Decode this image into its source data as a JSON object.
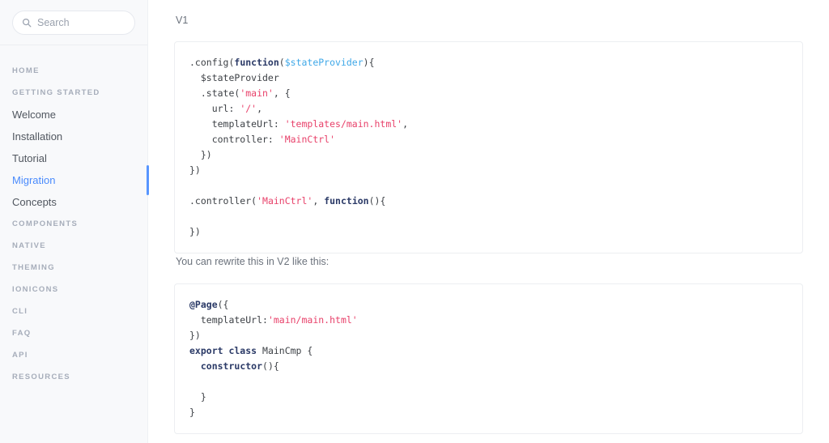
{
  "search": {
    "placeholder": "Search",
    "value": "",
    "icon": "search-icon"
  },
  "sidebar": {
    "items": [
      {
        "label": "HOME",
        "type": "section",
        "active": false
      },
      {
        "label": "GETTING STARTED",
        "type": "section",
        "active": false
      },
      {
        "label": "Welcome",
        "type": "link",
        "active": false
      },
      {
        "label": "Installation",
        "type": "link",
        "active": false
      },
      {
        "label": "Tutorial",
        "type": "link",
        "active": false
      },
      {
        "label": "Migration",
        "type": "link",
        "active": true
      },
      {
        "label": "Concepts",
        "type": "link",
        "active": false
      },
      {
        "label": "COMPONENTS",
        "type": "section",
        "active": false
      },
      {
        "label": "NATIVE",
        "type": "section",
        "active": false
      },
      {
        "label": "THEMING",
        "type": "section",
        "active": false
      },
      {
        "label": "IONICONS",
        "type": "section",
        "active": false
      },
      {
        "label": "CLI",
        "type": "section",
        "active": false
      },
      {
        "label": "FAQ",
        "type": "section",
        "active": false
      },
      {
        "label": "API",
        "type": "section",
        "active": false
      },
      {
        "label": "RESOURCES",
        "type": "section",
        "active": false
      }
    ],
    "active_label": "Migration",
    "accent_color": "#4a8bfc",
    "background_color": "#f8f9fb"
  },
  "main": {
    "heading_v1": "V1",
    "between_text": "You can rewrite this in V2 like this:",
    "code_v1_plain": ".config(function($stateProvider){\n  $stateProvider\n  .state('main', {\n    url: '/',\n    templateUrl: 'templates/main.html',\n    controller: 'MainCtrl'\n  })\n})\n\n.controller('MainCtrl', function(){\n\n})",
    "code_v2_plain": "@Page({\n  templateUrl:'main/main.html'\n})\nexport class MainCmp {\n  constructor(){\n\n  }\n}",
    "code_v1_tokens": [
      [
        {
          "t": ".config(",
          "c": "plain"
        },
        {
          "t": "function",
          "c": "kw"
        },
        {
          "t": "(",
          "c": "punc"
        },
        {
          "t": "$stateProvider",
          "c": "var"
        },
        {
          "t": "){",
          "c": "punc"
        }
      ],
      [
        {
          "t": "  $stateProvider",
          "c": "plain"
        }
      ],
      [
        {
          "t": "  .state(",
          "c": "plain"
        },
        {
          "t": "'main'",
          "c": "str"
        },
        {
          "t": ", {",
          "c": "punc"
        }
      ],
      [
        {
          "t": "    url: ",
          "c": "plain"
        },
        {
          "t": "'/'",
          "c": "str"
        },
        {
          "t": ",",
          "c": "punc"
        }
      ],
      [
        {
          "t": "    templateUrl: ",
          "c": "plain"
        },
        {
          "t": "'templates/main.html'",
          "c": "str"
        },
        {
          "t": ",",
          "c": "punc"
        }
      ],
      [
        {
          "t": "    controller: ",
          "c": "plain"
        },
        {
          "t": "'MainCtrl'",
          "c": "str"
        }
      ],
      [
        {
          "t": "  })",
          "c": "plain"
        }
      ],
      [
        {
          "t": "})",
          "c": "plain"
        }
      ],
      [
        {
          "t": "",
          "c": "plain"
        }
      ],
      [
        {
          "t": ".controller(",
          "c": "plain"
        },
        {
          "t": "'MainCtrl'",
          "c": "str"
        },
        {
          "t": ", ",
          "c": "punc"
        },
        {
          "t": "function",
          "c": "kw"
        },
        {
          "t": "(){",
          "c": "punc"
        }
      ],
      [
        {
          "t": "",
          "c": "plain"
        }
      ],
      [
        {
          "t": "})",
          "c": "plain"
        }
      ]
    ],
    "code_v2_tokens": [
      [
        {
          "t": "@Page",
          "c": "kw"
        },
        {
          "t": "({",
          "c": "punc"
        }
      ],
      [
        {
          "t": "  templateUrl:",
          "c": "plain"
        },
        {
          "t": "'main/main.html'",
          "c": "str"
        }
      ],
      [
        {
          "t": "})",
          "c": "plain"
        }
      ],
      [
        {
          "t": "export class",
          "c": "kw"
        },
        {
          "t": " MainCmp {",
          "c": "plain"
        }
      ],
      [
        {
          "t": "  ",
          "c": "plain"
        },
        {
          "t": "constructor",
          "c": "kw"
        },
        {
          "t": "(){",
          "c": "punc"
        }
      ],
      [
        {
          "t": "",
          "c": "plain"
        }
      ],
      [
        {
          "t": "  }",
          "c": "plain"
        }
      ],
      [
        {
          "t": "}",
          "c": "plain"
        }
      ]
    ]
  },
  "colors": {
    "accent": "#4a8bfc",
    "keyword": "#2b3a67",
    "string": "#e8416a",
    "variable": "#3fa8e8",
    "code_text": "#3d4146",
    "body_text": "#6b727c"
  }
}
